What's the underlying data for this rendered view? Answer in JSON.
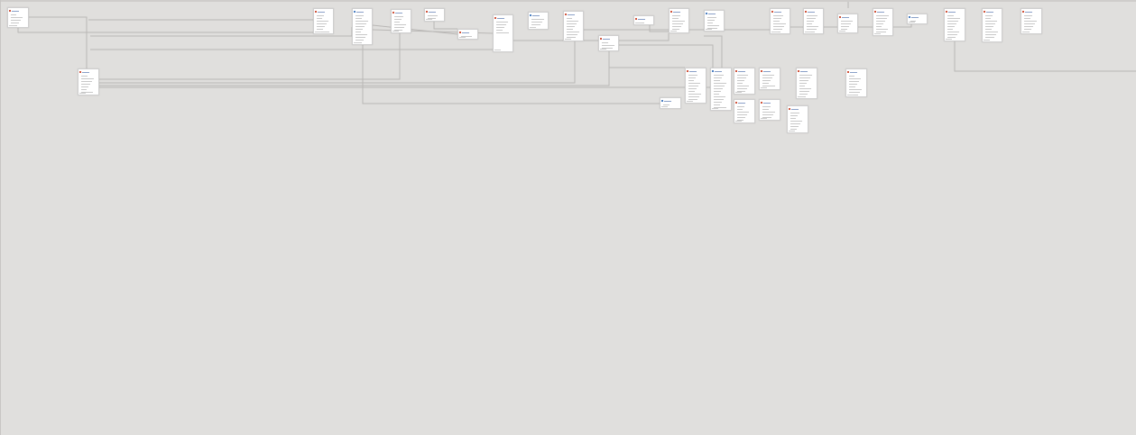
{
  "diagram": {
    "type": "entity-relationship",
    "tables": [
      {
        "id": "t1",
        "rows": 6
      },
      {
        "id": "t2",
        "rows": 9
      },
      {
        "id": "t3",
        "rows": 9
      },
      {
        "id": "t4",
        "rows": 13
      },
      {
        "id": "t5",
        "rows": 8
      },
      {
        "id": "t6",
        "rows": 3
      },
      {
        "id": "t7",
        "rows": 3
      },
      {
        "id": "t8",
        "rows": 5
      },
      {
        "id": "t9",
        "rows": 3
      },
      {
        "id": "t10",
        "rows": 10
      },
      {
        "id": "t11",
        "rows": 4
      },
      {
        "id": "t12",
        "rows": 2
      },
      {
        "id": "t13",
        "rows": 8
      },
      {
        "id": "t14",
        "rows": 6
      },
      {
        "id": "t15",
        "rows": 8
      },
      {
        "id": "t16",
        "rows": 8
      },
      {
        "id": "t17",
        "rows": 4
      },
      {
        "id": "t18",
        "rows": 7
      },
      {
        "id": "t19",
        "rows": 2
      },
      {
        "id": "t20",
        "rows": 9
      },
      {
        "id": "t21",
        "rows": 9
      },
      {
        "id": "t22",
        "rows": 8
      },
      {
        "id": "t23",
        "rows": 12
      },
      {
        "id": "t24",
        "rows": 14
      },
      {
        "id": "t25",
        "rows": 8
      },
      {
        "id": "t26",
        "rows": 6
      },
      {
        "id": "t27",
        "rows": 9
      },
      {
        "id": "t28",
        "rows": 9
      },
      {
        "id": "t29",
        "rows": 3
      },
      {
        "id": "t30",
        "rows": 7
      },
      {
        "id": "t31",
        "rows": 6
      },
      {
        "id": "t32",
        "rows": 8
      }
    ]
  }
}
